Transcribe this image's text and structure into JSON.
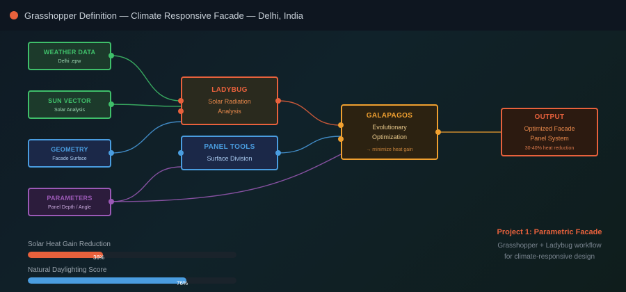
{
  "header": {
    "title": "Grasshopper Definition — Climate Responsive Facade — Delhi, India"
  },
  "nodes": {
    "weather": {
      "title": "WEATHER DATA",
      "subtitle": "Delhi .epw"
    },
    "sun": {
      "title": "SUN VECTOR",
      "subtitle": "Solar Analysis"
    },
    "geometry": {
      "title": "GEOMETRY",
      "subtitle": "Facade Surface"
    },
    "parameters": {
      "title": "PARAMETERS",
      "subtitle": "Panel Depth / Angle"
    },
    "ladybug": {
      "title": "LADYBUG",
      "line1": "Solar Radiation",
      "line2": "Analysis"
    },
    "panel": {
      "title": "PANEL TOOLS",
      "line1": "Surface Division"
    },
    "galapagos": {
      "title": "GALAPAGOS",
      "line1": "Evolutionary",
      "line2": "Optimization",
      "note": "→ minimize heat gain"
    },
    "output": {
      "title": "OUTPUT",
      "line1": "Optimized Facade",
      "line2": "Panel System",
      "note": "30-40% heat reduction"
    }
  },
  "metrics": [
    {
      "label": "Solar Heat Gain Reduction",
      "value_text": "36%",
      "value": 0.36,
      "color": "#e8613c"
    },
    {
      "label": "Natural Daylighting Score",
      "value_text": "76%",
      "value": 0.76,
      "color": "#4a9de0"
    }
  ],
  "project": {
    "heading": "Project 1: Parametric Facade",
    "line1": "Grasshopper + Ladybug workflow",
    "line2": "for climate-responsive design"
  },
  "colors": {
    "accent": "#e8613c",
    "green": "#3fbf6a",
    "blue": "#4a9de0",
    "purple": "#9b59b6",
    "orange": "#f0a030"
  }
}
